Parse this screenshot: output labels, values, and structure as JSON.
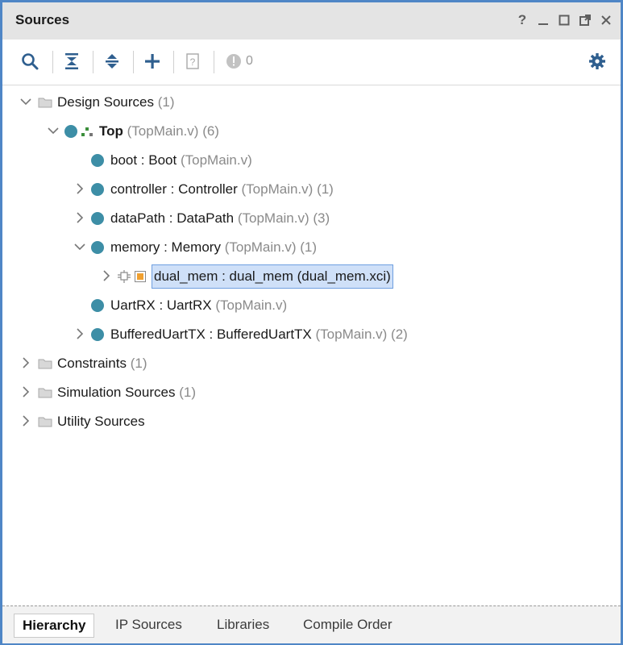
{
  "panel": {
    "title": "Sources",
    "controls": {
      "help": "?",
      "minimize": "_",
      "maximize": "□",
      "float": "⧉",
      "close": "✕"
    }
  },
  "toolbar": {
    "icons": [
      "search-icon",
      "collapse-all-icon",
      "expand-all-icon",
      "add-icon",
      "unknown-file-icon",
      "status-circle-icon",
      "gear-icon"
    ],
    "count": "0"
  },
  "tree": {
    "design_sources": {
      "label": "Design Sources",
      "count": "(1)"
    },
    "top": {
      "name": "Top",
      "file": "(TopMain.v)",
      "count": "(6)"
    },
    "children": [
      {
        "inst": "boot : Boot",
        "file": "(TopMain.v)",
        "count": ""
      },
      {
        "inst": "controller : Controller",
        "file": "(TopMain.v)",
        "count": "(1)"
      },
      {
        "inst": "dataPath : DataPath",
        "file": "(TopMain.v)",
        "count": "(3)"
      },
      {
        "inst": "memory : Memory",
        "file": "(TopMain.v)",
        "count": "(1)"
      }
    ],
    "dual_mem": {
      "label": "dual_mem : dual_mem (dual_mem.xci)"
    },
    "children2": [
      {
        "inst": "UartRX : UartRX",
        "file": "(TopMain.v)",
        "count": ""
      },
      {
        "inst": "BufferedUartTX : BufferedUartTX",
        "file": "(TopMain.v)",
        "count": "(2)"
      }
    ],
    "constraints": {
      "label": "Constraints",
      "count": "(1)"
    },
    "simulation": {
      "label": "Simulation Sources",
      "count": "(1)"
    },
    "utility": {
      "label": "Utility Sources",
      "count": ""
    }
  },
  "tabs": [
    {
      "label": "Hierarchy",
      "active": true
    },
    {
      "label": "IP Sources",
      "active": false
    },
    {
      "label": "Libraries",
      "active": false
    },
    {
      "label": "Compile Order",
      "active": false
    }
  ]
}
